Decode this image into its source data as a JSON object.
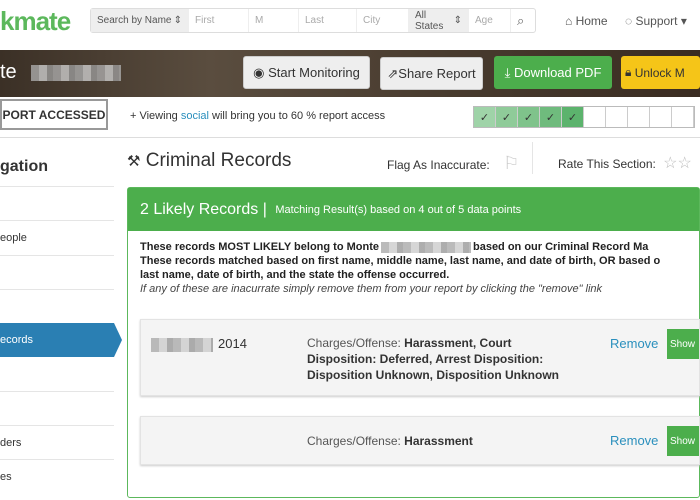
{
  "header": {
    "logo": "kmate",
    "search": {
      "type": "Search by Name",
      "first": "First",
      "middle": "M",
      "last": "Last",
      "city": "City",
      "state": "All States",
      "age": "Age"
    },
    "home": "Home",
    "support": "Support"
  },
  "banner": {
    "name": "te",
    "buttons": {
      "monitor": "Start Monitoring",
      "share": "Share Report",
      "pdf": "Download PDF",
      "unlock": "Unlock M"
    }
  },
  "access": {
    "label": "PORT ACCESSED",
    "pre": "+ Viewing ",
    "link": "social",
    "post": " will bring you to 60 % report access",
    "progress_checked": 5,
    "progress_total": 10,
    "check": "✓"
  },
  "sidebar": {
    "heading": "gation",
    "items": [
      "",
      "eople",
      "",
      "",
      "ecords",
      "",
      "ders",
      "es"
    ],
    "active_index": 4
  },
  "section": {
    "title": "Criminal Records",
    "flag_label": "Flag As Inaccurate:",
    "rate_label": "Rate This Section:",
    "rating": 0
  },
  "results": {
    "count": "2 Likely Records",
    "sep": " | ",
    "subtitle": "Matching Result(s) based on 4 out of 5 data points",
    "line1a": "These records MOST LIKELY belong to Monte",
    "line1b": "based on our Criminal Record Ma",
    "line2": "These records matched based on first name, middle name, last name, and date of birth, OR based o",
    "line3": "last name, date of birth, and the state the offense occurred.",
    "note": "If any of these are inacurrate simply remove them from your report by clicking the \"remove\" link",
    "records": [
      {
        "date": "2014",
        "label": "Charges/Offense: ",
        "charges": "Harassment, Court Disposition: Deferred, Arrest Disposition: Disposition Unknown, Disposition Unknown",
        "remove": "Remove",
        "show": "Show"
      },
      {
        "date": "",
        "label": "Charges/Offense: ",
        "charges": "Harassment",
        "remove": "Remove",
        "show": "Show"
      }
    ]
  }
}
